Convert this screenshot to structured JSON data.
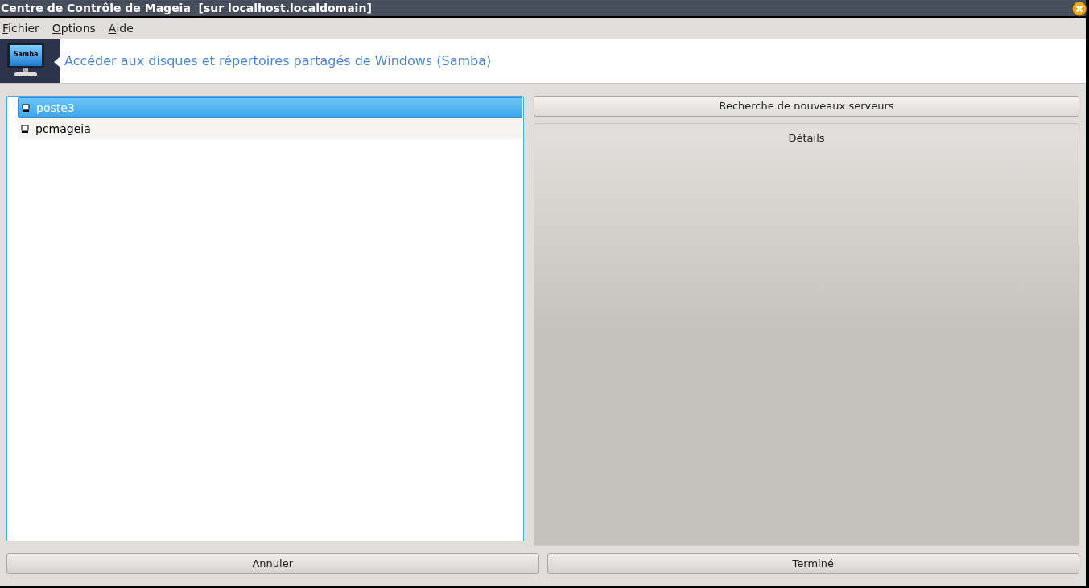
{
  "window": {
    "title": "Centre de Contrôle de Mageia  [sur localhost.localdomain]"
  },
  "menu": [
    "Fichier",
    "Options",
    "Aide"
  ],
  "banner": {
    "icon_label": "Samba",
    "title": "Accéder aux disques et répertoires partagés de Windows (Samba)"
  },
  "servers": [
    {
      "name": "poste3",
      "selected": true
    },
    {
      "name": "pcmageia",
      "selected": false
    }
  ],
  "search_button": "Recherche de nouveaux serveurs",
  "details": {
    "title": "Détails"
  },
  "buttons": [
    "Annuler",
    "Terminé"
  ]
}
